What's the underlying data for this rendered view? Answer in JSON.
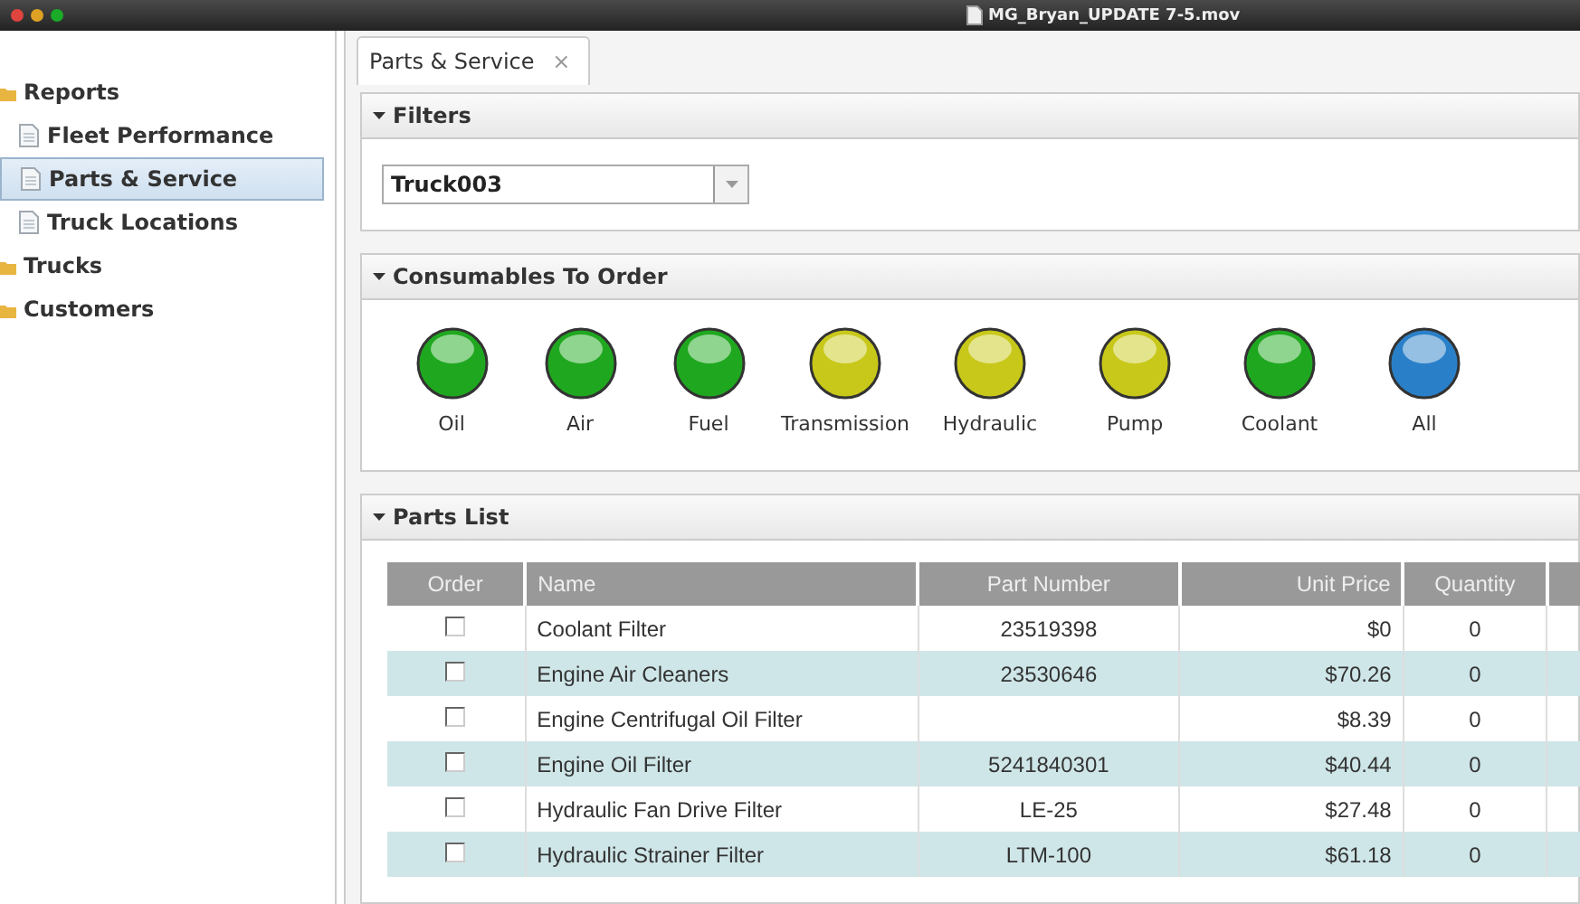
{
  "window": {
    "title": "MG_Bryan_UPDATE 7-5.mov"
  },
  "sidebar": {
    "items": [
      {
        "label": "Reports",
        "selected": false,
        "children": [
          {
            "label": "Fleet Performance",
            "selected": false
          },
          {
            "label": "Parts & Service",
            "selected": true
          },
          {
            "label": "Truck Locations",
            "selected": false
          }
        ]
      },
      {
        "label": "Trucks",
        "selected": false
      },
      {
        "label": "Customers",
        "selected": false
      }
    ]
  },
  "tabs": [
    {
      "label": "Parts & Service",
      "selected": true,
      "close": "×"
    }
  ],
  "filters": {
    "title": "Filters",
    "truck": {
      "value": "Truck003"
    }
  },
  "consumables": {
    "title": "Consumables To Order",
    "lights": [
      {
        "label": "Oil",
        "color": "#1fa81f"
      },
      {
        "label": "Air",
        "color": "#1fa81f"
      },
      {
        "label": "Fuel",
        "color": "#1fa81f"
      },
      {
        "label": "Transmission",
        "color": "#c8c81a"
      },
      {
        "label": "Hydraulic",
        "color": "#c8c81a"
      },
      {
        "label": "Pump",
        "color": "#c8c81a"
      },
      {
        "label": "Coolant",
        "color": "#1fa81f"
      },
      {
        "label": "All",
        "color": "#2a80c8"
      }
    ]
  },
  "parts": {
    "title": "Parts List",
    "columns": [
      "Order",
      "Name",
      "Part Number",
      "Unit Price",
      "Quantity"
    ],
    "rows": [
      {
        "checked": false,
        "name": "Coolant Filter",
        "part_number": "23519398",
        "unit_price": "$0",
        "quantity": "0"
      },
      {
        "checked": false,
        "name": "Engine Air Cleaners",
        "part_number": "23530646",
        "unit_price": "$70.26",
        "quantity": "0"
      },
      {
        "checked": false,
        "name": "Engine Centrifugal Oil Filter",
        "unit_price": "$8.39",
        "quantity": "0"
      },
      {
        "checked": false,
        "name": "Engine Oil Filter",
        "part_number": "5241840301",
        "unit_price": "$40.44",
        "quantity": "0"
      },
      {
        "checked": false,
        "name": "Hydraulic Fan Drive Filter",
        "part_number": "LE-25",
        "unit_price": "$27.48",
        "quantity": "0"
      },
      {
        "checked": false,
        "name": "Hydraulic Strainer Filter",
        "part_number": "LTM-100",
        "unit_price": "$61.18",
        "quantity": "0"
      }
    ]
  }
}
